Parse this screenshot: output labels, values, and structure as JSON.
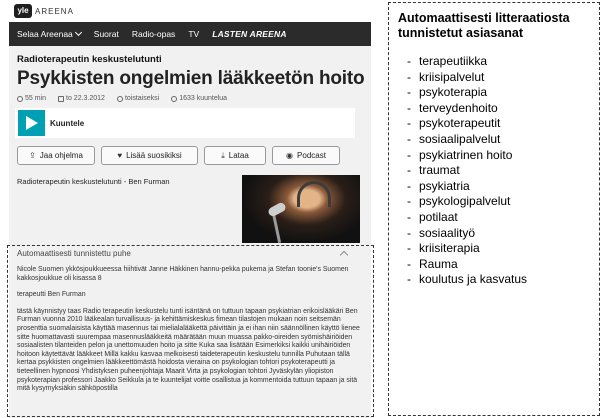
{
  "header": {
    "logo": "yle",
    "brand": "AREENA"
  },
  "nav": {
    "items": [
      {
        "label": "Selaa Areenaa",
        "dropdown": true
      },
      {
        "label": "Suorat"
      },
      {
        "label": "Radio-opas"
      },
      {
        "label": "TV"
      },
      {
        "label": "LASTEN AREENA"
      }
    ]
  },
  "program": {
    "series": "Radioterapeutin keskustelutunti",
    "title": "Psykkisten ongelmien lääkkeetön hoito",
    "meta": {
      "duration": "55 min",
      "date": "to 22.3.2012",
      "availability": "toistaiseksi",
      "listens": "1633 kuuntelua"
    },
    "player_label": "Kuuntele",
    "description": "Radioterapeutin keskustelutunti - Ben Furman"
  },
  "actions": [
    {
      "label": "Jaa ohjelma",
      "icon": "share-icon",
      "glyph": "⇪"
    },
    {
      "label": "Lisää suosikiksi",
      "icon": "heart-icon",
      "glyph": "♥"
    },
    {
      "label": "Lataa",
      "icon": "download-icon",
      "glyph": "⤓"
    },
    {
      "label": "Podcast",
      "icon": "podcast-icon",
      "glyph": "◉"
    }
  ],
  "transcript": {
    "heading": "Automaattisesti tunnistettu puhe",
    "paragraphs": [
      "Nicole Suomen ykkösjoukkueessa hiihtivät Janne Häkkinen hannu-pekka pukema ja Stefan toonie's Suomen kakkosjoukkue oli kisassa 8",
      "terapeutti Ben Furman",
      "tästä käynnistyy taas Radio terapeutin keskustelu tunti isäntänä on tuttuun tapaan psykiatrian erikoislääkäri Ben Furman vuonna 2010 lääkealan turvallisuus- ja kehittämiskeskus fimean tilastojen mukaan noin seitsemän prosenttia suomalaisista käyttää masennus tai mielialalääkettä päivittäin ja ei ihan niin säännöllinen käyttö lienee sitte huomattavasti suurempaa masennuslääkkeitä määrätään muun muassa pakko-oireiden syömishäiriöiden sosiaalisten tilanteiden pelon ja unettomuuden hoito ja sitte Kuka saa lisätään Esimerkiksi kaikki unihäiriöiden hoitoon käytettävät lääkkeet Millä kakku kasvaa melkoisesti taideterapeutin keskustelu tunnilla Puhutaan tällä kertaa psykkisten ongelmien lääkkeettömästä hoidosta vieraina on psykologian tohtori psykoterapeutti ja tieteellinen hypnoosi Yhdistyksen puheenjohtaja Maarit Virta ja psykologian tohtori Jyväskylän yliopiston psykoterapian professori Jaakko Seikkula ja te kuuntelijat voitte osallistua ja kommentoida tuttuun tapaan ja sitä mitä kysymyksiäkin sähköpostilla"
    ]
  },
  "keywords_panel": {
    "title": "Automaattisesti litteraatiosta tunnistetut asiasanat",
    "bullet": "-",
    "items": [
      "terapeutiikka",
      "kriisipalvelut",
      "psykoterapia",
      "terveydenhoito",
      "psykoterapeutit",
      "sosiaalipalvelut",
      "psykiatrinen hoito",
      "traumat",
      "psykiatria",
      "psykologipalvelut",
      "potilaat",
      "sosiaalityö",
      "kriisiterapia",
      "Rauma",
      "koulutus ja kasvatus"
    ]
  },
  "colors": {
    "accent": "#00a0b4",
    "nav_bg": "#2b2b2b",
    "page_bg": "#f1f1f1"
  }
}
